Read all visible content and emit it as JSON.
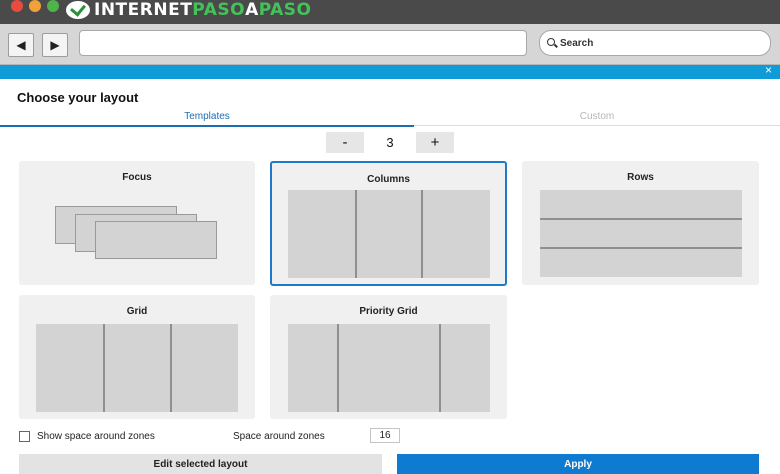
{
  "browser": {
    "brand_part1": "INTERNET",
    "brand_part2": "PASO",
    "brand_part3": "A",
    "brand_part4": "PASO",
    "back_icon": "back-arrow-icon",
    "forward_icon": "forward-arrow-icon",
    "search_placeholder": "Search",
    "accent_color": "#0f9bd7"
  },
  "window": {
    "close_glyph": "×"
  },
  "app": {
    "heading": "Choose your layout",
    "tabs": [
      {
        "label": "Templates",
        "active": true
      },
      {
        "label": "Custom",
        "active": false
      }
    ],
    "stepper": {
      "minus_label": "-",
      "value": "3",
      "plus_label": "+"
    },
    "layouts": [
      {
        "title": "Focus",
        "selected": false
      },
      {
        "title": "Columns",
        "selected": true
      },
      {
        "title": "Rows",
        "selected": false
      },
      {
        "title": "Grid",
        "selected": false
      },
      {
        "title": "Priority Grid",
        "selected": false
      }
    ],
    "show_space_label": "Show space around zones",
    "show_space_checked": false,
    "space_around_label": "Space around zones",
    "space_around_value": "16",
    "edit_button": "Edit selected layout",
    "apply_button": "Apply",
    "apply_color": "#0e7bd0"
  }
}
